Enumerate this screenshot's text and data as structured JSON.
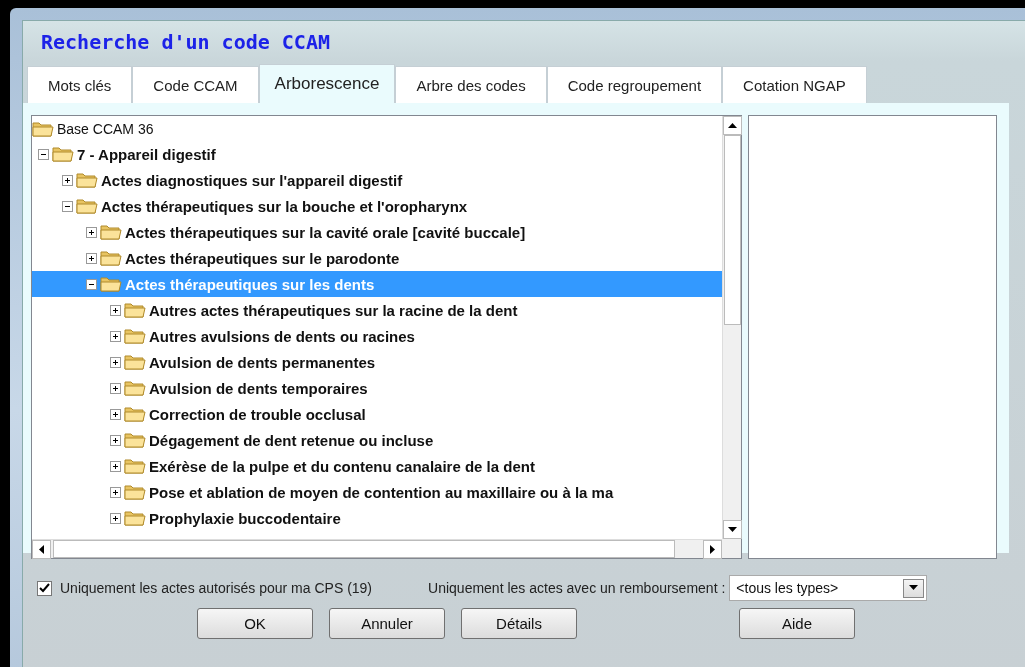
{
  "window": {
    "title": "Recherche d'un code CCAM"
  },
  "tabs": [
    {
      "label": "Mots clés",
      "selected": false
    },
    {
      "label": "Code CCAM",
      "selected": false
    },
    {
      "label": "Arborescence",
      "selected": true
    },
    {
      "label": "Arbre des codes",
      "selected": false
    },
    {
      "label": "Code regroupement",
      "selected": false
    },
    {
      "label": "Cotation NGAP",
      "selected": false
    }
  ],
  "tree": {
    "root": {
      "label": "Base CCAM 36",
      "children": [
        {
          "label": "7 - Appareil digestif",
          "expanded": true,
          "selected": false,
          "children": [
            {
              "label": "Actes diagnostiques sur l'appareil digestif",
              "expanded": false,
              "selected": false
            },
            {
              "label": "Actes thérapeutiques sur la bouche et l'oropharynx",
              "expanded": true,
              "selected": false,
              "children": [
                {
                  "label": "Actes thérapeutiques sur la cavité orale [cavité buccale]",
                  "expanded": false,
                  "selected": false
                },
                {
                  "label": "Actes thérapeutiques sur le parodonte",
                  "expanded": false,
                  "selected": false
                },
                {
                  "label": "Actes thérapeutiques sur les dents",
                  "expanded": true,
                  "selected": true,
                  "children": [
                    {
                      "label": "Autres actes thérapeutiques sur la racine de la dent",
                      "expanded": false,
                      "selected": false
                    },
                    {
                      "label": "Autres avulsions de dents ou racines",
                      "expanded": false,
                      "selected": false
                    },
                    {
                      "label": "Avulsion de dents permanentes",
                      "expanded": false,
                      "selected": false
                    },
                    {
                      "label": "Avulsion de dents temporaires",
                      "expanded": false,
                      "selected": false
                    },
                    {
                      "label": "Correction de trouble occlusal",
                      "expanded": false,
                      "selected": false
                    },
                    {
                      "label": "Dégagement de dent retenue ou incluse",
                      "expanded": false,
                      "selected": false
                    },
                    {
                      "label": "Exérèse de la pulpe et du contenu canalaire de la dent",
                      "expanded": false,
                      "selected": false
                    },
                    {
                      "label": "Pose et ablation de moyen de contention au maxillaire ou à la ma",
                      "expanded": false,
                      "selected": false
                    },
                    {
                      "label": "Prophylaxie buccodentaire",
                      "expanded": false,
                      "selected": false
                    }
                  ]
                }
              ]
            }
          ]
        }
      ]
    }
  },
  "filters": {
    "cps_only": {
      "label": "Uniquement les actes autorisés pour ma CPS (19)",
      "checked": true
    },
    "refund": {
      "label": "Uniquement les actes avec un remboursement :",
      "value": "<tous les types>"
    }
  },
  "buttons": [
    "OK",
    "Annuler",
    "Détails",
    "Aide"
  ]
}
